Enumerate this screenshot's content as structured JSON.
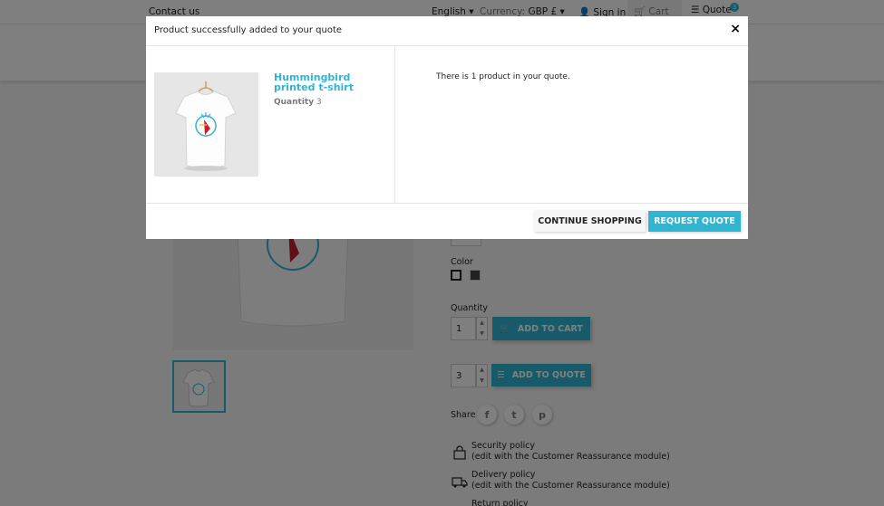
{
  "topbar": {
    "contact": "Contact us",
    "language": "English",
    "currency_label": "Currency:",
    "currency_value": "GBP £",
    "signin": "Sign in",
    "cart": "Cart (0)",
    "quote": "Quote",
    "quote_count": "3"
  },
  "product_page": {
    "color_label": "Color",
    "quantity_label": "Quantity",
    "quantity_value": "1",
    "add_to_cart": "Add to cart",
    "quote_quantity_value": "3",
    "add_to_quote": "Add to quote",
    "share_label": "Share",
    "policies": [
      {
        "title": "Security policy",
        "note": "(edit with the Customer Reassurance module)"
      },
      {
        "title": "Delivery policy",
        "note": "(edit with the Customer Reassurance module)"
      },
      {
        "title": "Return policy",
        "note": ""
      }
    ]
  },
  "modal": {
    "title": "Product successfully added to your quote",
    "close": "×",
    "product_name": "Hummingbird printed t-shirt",
    "quantity_label": "Quantity",
    "quantity_value": "3",
    "message": "There is 1 product in your quote.",
    "continue_button": "Continue shopping",
    "request_button": "Request quote"
  },
  "colors": {
    "accent": "#2fb5d2",
    "overlay": "rgba(0,0,0,0.5)"
  }
}
